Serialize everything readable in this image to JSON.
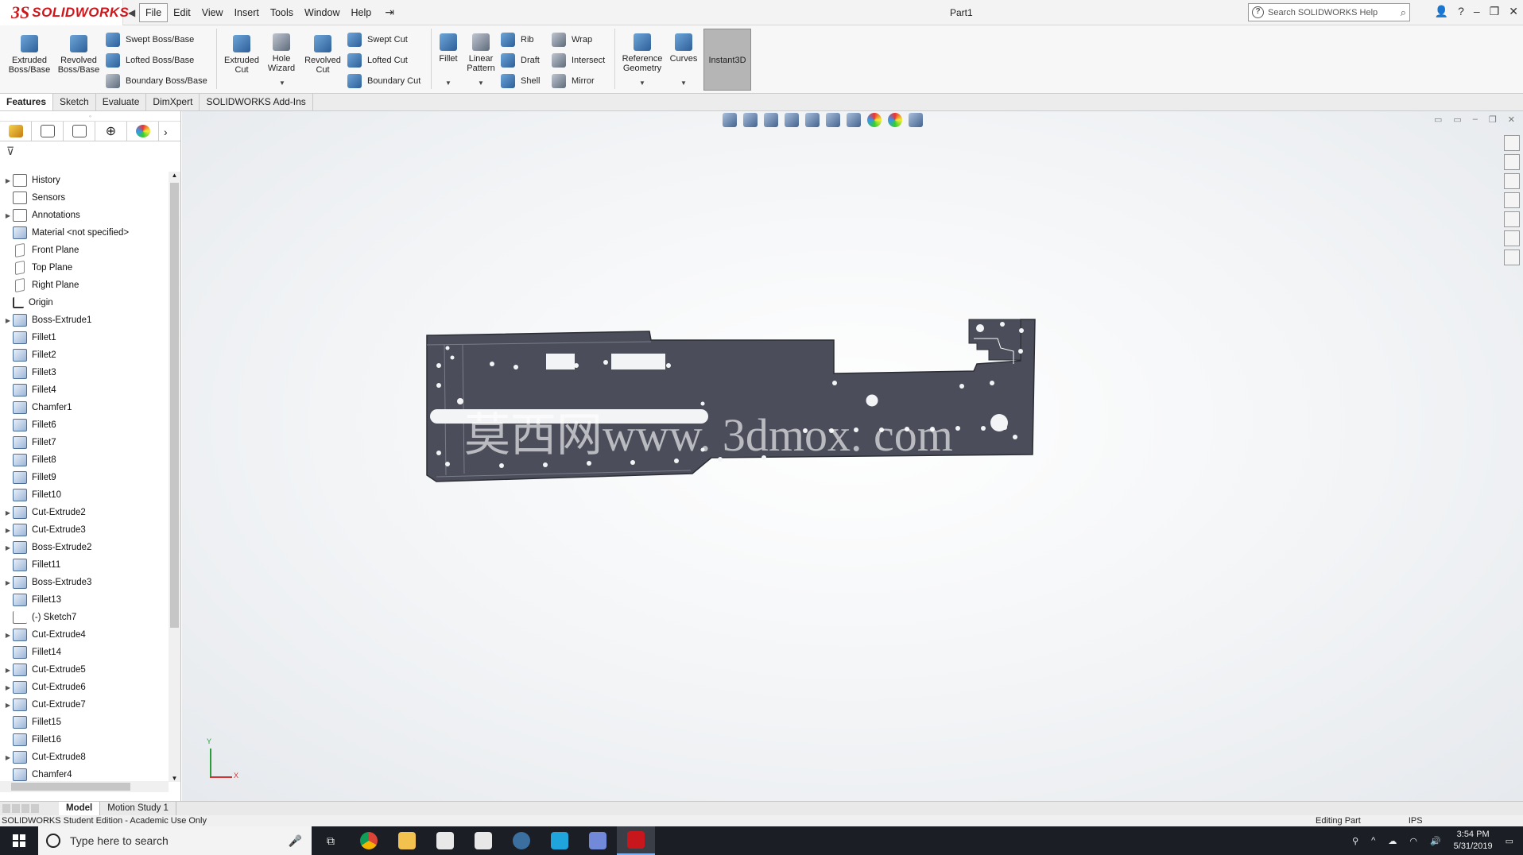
{
  "app": {
    "logo_ds": "3S",
    "logo_name": "SOLIDWORKS",
    "document_title": "Part1",
    "search_placeholder": "Search SOLIDWORKS Help"
  },
  "menu": [
    "File",
    "Edit",
    "View",
    "Insert",
    "Tools",
    "Window",
    "Help"
  ],
  "commands": {
    "extruded_boss": "Extruded\nBoss/Base",
    "revolved_boss": "Revolved\nBoss/Base",
    "swept_boss": "Swept Boss/Base",
    "lofted_boss": "Lofted Boss/Base",
    "boundary_boss": "Boundary Boss/Base",
    "extruded_cut": "Extruded\nCut",
    "hole_wizard": "Hole\nWizard",
    "revolved_cut": "Revolved\nCut",
    "swept_cut": "Swept Cut",
    "lofted_cut": "Lofted Cut",
    "boundary_cut": "Boundary Cut",
    "fillet": "Fillet",
    "linear_pattern": "Linear\nPattern",
    "rib": "Rib",
    "draft": "Draft",
    "shell": "Shell",
    "wrap": "Wrap",
    "intersect": "Intersect",
    "mirror": "Mirror",
    "reference_geometry": "Reference\nGeometry",
    "curves": "Curves",
    "instant3d": "Instant3D"
  },
  "tabs": [
    "Features",
    "Sketch",
    "Evaluate",
    "DimXpert",
    "SOLIDWORKS Add-Ins"
  ],
  "tree": [
    {
      "label": "History",
      "expandable": true,
      "icon": "folder"
    },
    {
      "label": "Sensors",
      "expandable": false,
      "icon": "folder"
    },
    {
      "label": "Annotations",
      "expandable": true,
      "icon": "folder"
    },
    {
      "label": "Material <not specified>",
      "expandable": false,
      "icon": "material"
    },
    {
      "label": "Front Plane",
      "expandable": false,
      "icon": "plane"
    },
    {
      "label": "Top Plane",
      "expandable": false,
      "icon": "plane"
    },
    {
      "label": "Right Plane",
      "expandable": false,
      "icon": "plane"
    },
    {
      "label": "Origin",
      "expandable": false,
      "icon": "origin"
    },
    {
      "label": "Boss-Extrude1",
      "expandable": true,
      "icon": "feature"
    },
    {
      "label": "Fillet1",
      "expandable": false,
      "icon": "feature"
    },
    {
      "label": "Fillet2",
      "expandable": false,
      "icon": "feature"
    },
    {
      "label": "Fillet3",
      "expandable": false,
      "icon": "feature"
    },
    {
      "label": "Fillet4",
      "expandable": false,
      "icon": "feature"
    },
    {
      "label": "Chamfer1",
      "expandable": false,
      "icon": "feature"
    },
    {
      "label": "Fillet6",
      "expandable": false,
      "icon": "feature"
    },
    {
      "label": "Fillet7",
      "expandable": false,
      "icon": "feature"
    },
    {
      "label": "Fillet8",
      "expandable": false,
      "icon": "feature"
    },
    {
      "label": "Fillet9",
      "expandable": false,
      "icon": "feature"
    },
    {
      "label": "Fillet10",
      "expandable": false,
      "icon": "feature"
    },
    {
      "label": "Cut-Extrude2",
      "expandable": true,
      "icon": "feature"
    },
    {
      "label": "Cut-Extrude3",
      "expandable": true,
      "icon": "feature"
    },
    {
      "label": "Boss-Extrude2",
      "expandable": true,
      "icon": "feature"
    },
    {
      "label": "Fillet11",
      "expandable": false,
      "icon": "feature"
    },
    {
      "label": "Boss-Extrude3",
      "expandable": true,
      "icon": "feature"
    },
    {
      "label": "Fillet13",
      "expandable": false,
      "icon": "feature"
    },
    {
      "label": "(-) Sketch7",
      "expandable": false,
      "icon": "sketch"
    },
    {
      "label": "Cut-Extrude4",
      "expandable": true,
      "icon": "feature"
    },
    {
      "label": "Fillet14",
      "expandable": false,
      "icon": "feature"
    },
    {
      "label": "Cut-Extrude5",
      "expandable": true,
      "icon": "feature"
    },
    {
      "label": "Cut-Extrude6",
      "expandable": true,
      "icon": "feature"
    },
    {
      "label": "Cut-Extrude7",
      "expandable": true,
      "icon": "feature"
    },
    {
      "label": "Fillet15",
      "expandable": false,
      "icon": "feature"
    },
    {
      "label": "Fillet16",
      "expandable": false,
      "icon": "feature"
    },
    {
      "label": "Cut-Extrude8",
      "expandable": true,
      "icon": "feature"
    },
    {
      "label": "Chamfer4",
      "expandable": false,
      "icon": "feature"
    }
  ],
  "viewport": {
    "watermark": "莫西网www. 3dmox. com",
    "triad_x": "X",
    "triad_y": "Y"
  },
  "bottom_tabs": [
    "Model",
    "Motion Study 1"
  ],
  "status": {
    "left": "SOLIDWORKS Student Edition - Academic Use Only",
    "mode": "Editing Part",
    "units": "IPS"
  },
  "taskbar": {
    "search_placeholder": "Type here to search",
    "time": "3:54 PM",
    "date": "5/31/2019"
  },
  "colors": {
    "brand_red": "#d0161b",
    "part_body": "#4b4e5a",
    "taskbar": "#1b1f25"
  }
}
